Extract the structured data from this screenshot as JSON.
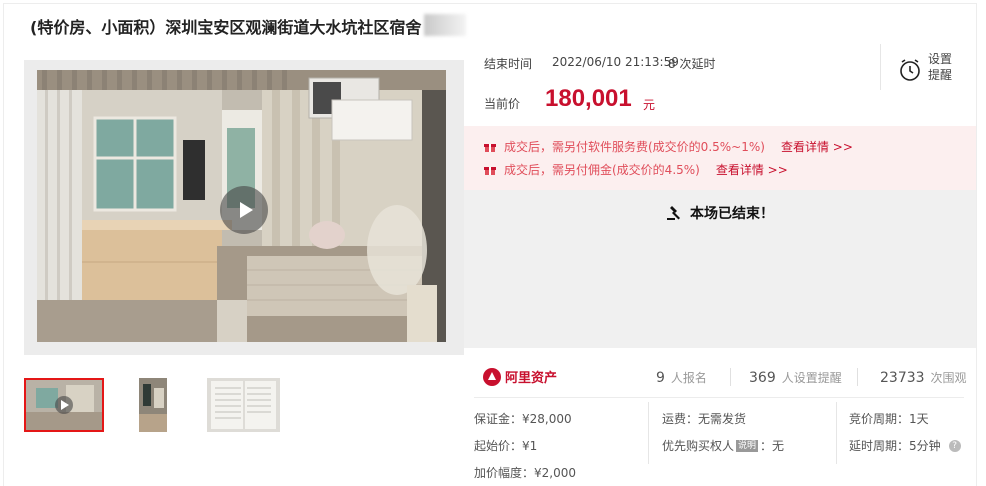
{
  "title": "(特价房、小面积）深圳宝安区观澜街道大水坑社区宿舍",
  "auction": {
    "end_label": "结束时间",
    "end_time": "2022/06/10 21:13:59",
    "delay_count": "8 次延时",
    "remind_label": "设置提醒",
    "price_label": "当前价",
    "price": "180,001",
    "price_unit": "元"
  },
  "fees": [
    {
      "text": "成交后，需另付软件服务费(成交价的0.5%~1%)",
      "link": "查看详情 >>"
    },
    {
      "text": "成交后，需另付佣金(成交价的4.5%)",
      "link": "查看详情 >>"
    }
  ],
  "status": "本场已结束！",
  "brand": "阿里资产",
  "stats": [
    {
      "value": "9",
      "label": "人报名"
    },
    {
      "value": "369",
      "label": "人设置提醒"
    },
    {
      "value": "23733",
      "label": "次围观"
    }
  ],
  "details": {
    "deposit": "保证金：¥28,000",
    "start_price": "起始价：¥1",
    "increment": "加价幅度：¥2,000",
    "shipping": "运费：无需发货",
    "priority_label": "优先购买权人",
    "priority_badge": "说明",
    "priority_value": "：无",
    "cycle": "竞价周期：1天",
    "delay_cycle": "延时周期：5分钟",
    "help": "?"
  },
  "colors": {
    "accent": "#c8102e",
    "fee_bg": "#fcefef",
    "ended_bg": "#f0f0f0"
  },
  "icons": [
    "play-icon",
    "alarm-clock-icon",
    "gift-icon",
    "gavel-icon",
    "ali-logo-icon",
    "help-icon"
  ]
}
